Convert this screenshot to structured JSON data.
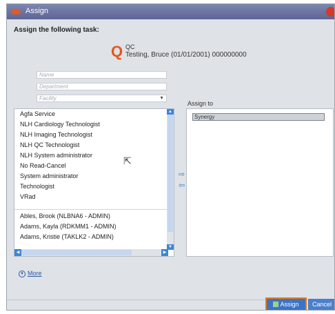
{
  "window": {
    "title": "Assign"
  },
  "heading": "Assign the following task:",
  "task": {
    "icon_letter": "Q",
    "code": "QC",
    "description": "Testing, Bruce (01/01/2001) 000000000"
  },
  "filters": {
    "name_placeholder": "Name",
    "department_placeholder": "Department",
    "facility_placeholder": "Facility"
  },
  "available": {
    "groups": [
      "Agfa Service",
      "NLH Cardiology Technologist",
      "NLH Imaging Technologist",
      "NLH QC Technologist",
      "NLH System administrator",
      "No Read-Cancel",
      "System administrator",
      "Technologist",
      "VRad"
    ],
    "users": [
      "Ables, Brook (NLBNA6 - ADMIN)",
      "Adams, Kayla (RDKMM1 - ADMIN)",
      "Adams, Kristie (TAKLK2 - ADMIN)"
    ]
  },
  "assign_to": {
    "label": "Assign to",
    "items": [
      "Synergy"
    ]
  },
  "more_link": "More",
  "buttons": {
    "assign": "Assign",
    "cancel": "Cancel"
  },
  "icons": {
    "add": "arrow-right-icon",
    "remove": "arrow-left-icon",
    "more": "chevron-down-circle-icon"
  },
  "colors": {
    "titlebar": "#5c6595",
    "accent": "#e87a12",
    "button": "#3a74c8"
  }
}
